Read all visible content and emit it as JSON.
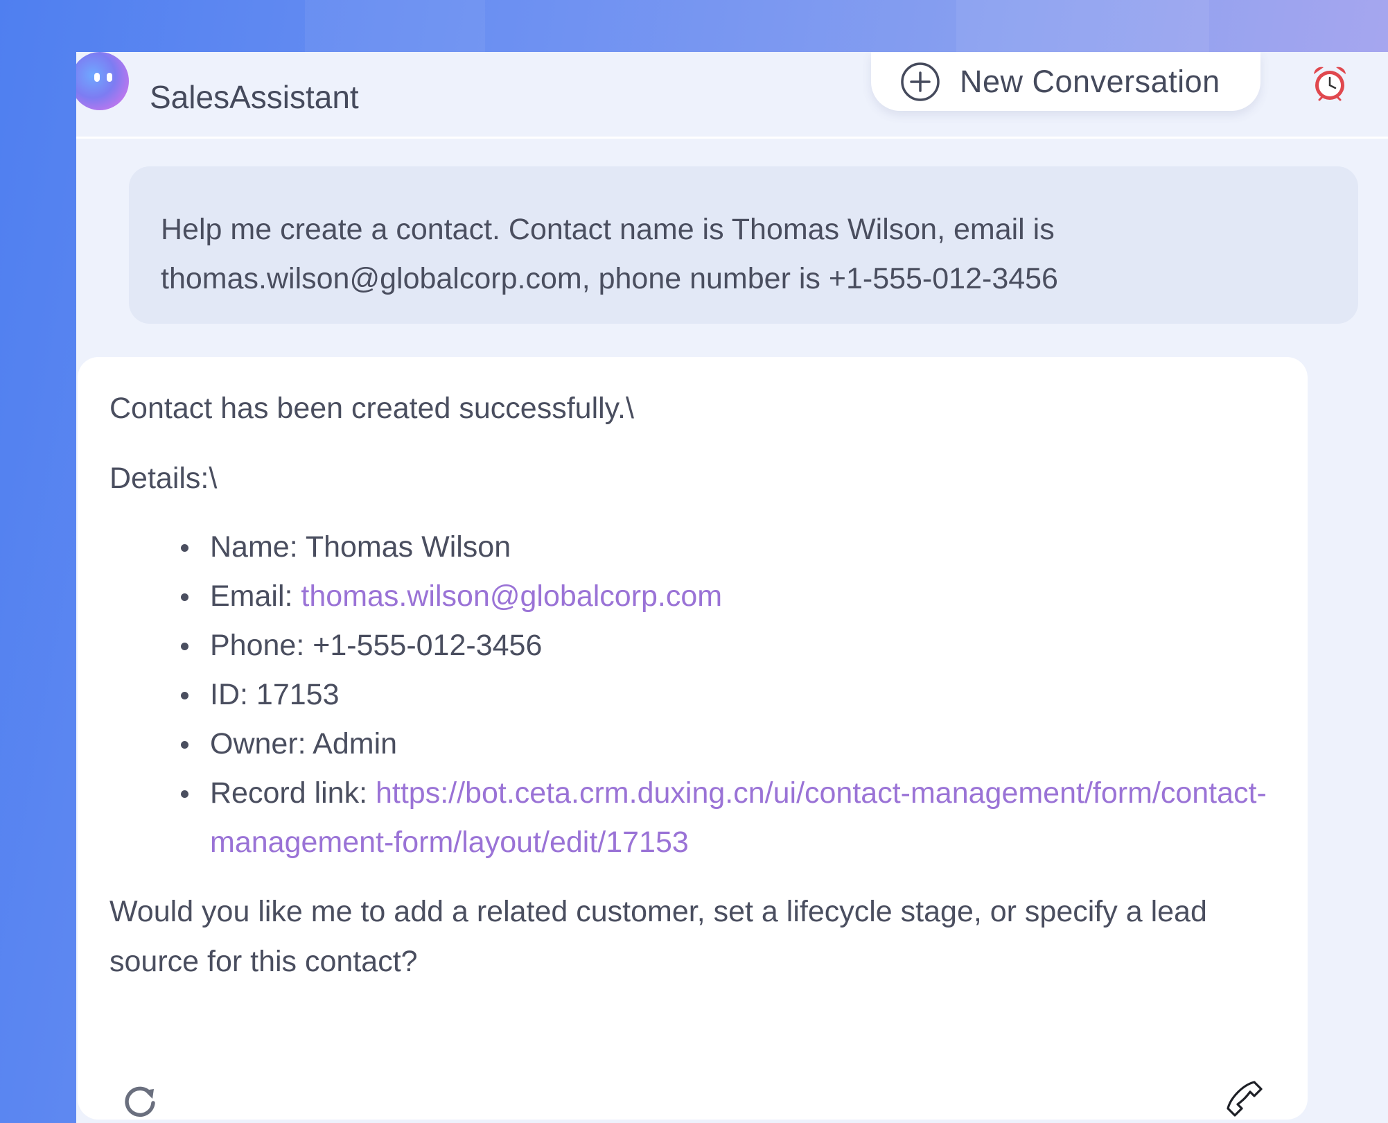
{
  "app": {
    "title": "SalesAssistant",
    "new_conversation_label": "New Conversation"
  },
  "icons": {
    "logo": "assistant-face-logo",
    "new_conversation": "plus-circle-icon",
    "history": "alarm-clock-icon",
    "regenerate": "refresh-icon",
    "call": "phone-icon"
  },
  "colors": {
    "link": "#9a73d6",
    "text": "#4a4e5f",
    "user_bubble": "#e2e8f6",
    "app_bg": "#eef2fc"
  },
  "messages": {
    "user": {
      "text": "Help me create a contact. Contact name is Thomas Wilson, email is thomas.wilson@globalcorp.com, phone number is +1-555-012-3456"
    },
    "assistant": {
      "line1": "Contact has been created successfully.\\",
      "line2": "Details:\\",
      "details": [
        {
          "label": "Name: ",
          "value": "Thomas Wilson"
        },
        {
          "label": "Email: ",
          "value": "thomas.wilson@globalcorp.com"
        },
        {
          "label": "Phone: ",
          "value": "+1-555-012-3456"
        },
        {
          "label": "ID: ",
          "value": "17153"
        },
        {
          "label": "Owner: ",
          "value": "Admin"
        },
        {
          "label": "Record link: ",
          "value": "https://bot.ceta.crm.duxing.cn/ui/contact-management/form/contact-management-form/layout/edit/17153"
        }
      ],
      "followup": "Would you like me to add a related customer, set a lifecycle stage, or specify a lead source for this contact?"
    }
  }
}
